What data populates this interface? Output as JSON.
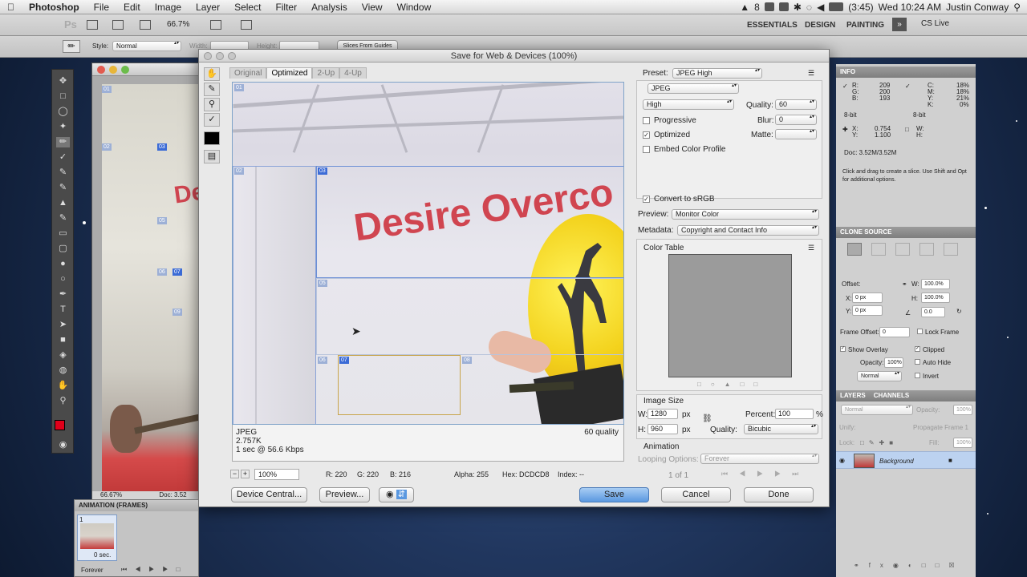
{
  "menubar": {
    "app": "Photoshop",
    "items": [
      "File",
      "Edit",
      "Image",
      "Layer",
      "Select",
      "Filter",
      "Analysis",
      "View",
      "Window"
    ],
    "status": {
      "adobe": "8",
      "battery": "(3:45)",
      "clock": "Wed 10:24 AM",
      "user": "Justin Conway"
    }
  },
  "options": {
    "logo": "Ps",
    "zoom": "66.7%",
    "workspaces": [
      "ESSENTIALS",
      "DESIGN",
      "PAINTING"
    ],
    "cslive": "CS Live",
    "style_label": "Style:",
    "style_value": "Normal",
    "width_label": "Width:",
    "height_label": "Height:",
    "slices_button": "Slices From Guides"
  },
  "doc": {
    "zoom": "66.67%",
    "doc_label": "Doc: 3.52",
    "slices": [
      "01",
      "02",
      "03",
      "05",
      "06",
      "07",
      "09"
    ]
  },
  "dialog": {
    "title": "Save for Web & Devices (100%)",
    "tabs": [
      "Original",
      "Optimized",
      "2-Up",
      "4-Up"
    ],
    "active_tab": "Optimized",
    "banner": "Desire Overco",
    "slices": [
      "01",
      "02",
      "03",
      "05",
      "06",
      "07",
      "08"
    ],
    "info": {
      "format": "JPEG",
      "size": "2.757K",
      "time": "1 sec @ 56.6 Kbps",
      "quality": "60 quality"
    },
    "status": {
      "zoom": "100%",
      "r": "R: 220",
      "g": "G: 220",
      "b": "B: 216",
      "alpha": "Alpha: 255",
      "hex": "Hex: DCDCD8",
      "index": "Index: --"
    },
    "buttons": {
      "device_central": "Device Central...",
      "preview": "Preview...",
      "save": "Save",
      "cancel": "Cancel",
      "done": "Done"
    },
    "settings": {
      "preset_label": "Preset:",
      "preset": "JPEG High",
      "format": "JPEG",
      "quality_level": "High",
      "quality_label": "Quality:",
      "quality": "60",
      "blur_label": "Blur:",
      "blur": "0",
      "matte_label": "Matte:",
      "progressive": "Progressive",
      "optimized": "Optimized",
      "embed": "Embed Color Profile",
      "convert": "Convert to sRGB",
      "preview_label": "Preview:",
      "preview": "Monitor Color",
      "metadata_label": "Metadata:",
      "metadata": "Copyright and Contact Info",
      "color_table": "Color Table"
    },
    "image_size": {
      "title": "Image Size",
      "w_label": "W:",
      "w": "1280",
      "h_label": "H:",
      "h": "960",
      "unit": "px",
      "percent_label": "Percent:",
      "percent": "100",
      "pct": "%",
      "quality_label": "Quality:",
      "quality": "Bicubic"
    },
    "animation": {
      "title": "Animation",
      "looping_label": "Looping Options:",
      "looping": "Forever",
      "frame": "1 of 1"
    }
  },
  "info_panel": {
    "title": "INFO",
    "r": "209",
    "g": "200",
    "b": "193",
    "c": "18%",
    "m": "18%",
    "y": "21%",
    "k": "0%",
    "bits1": "8-bit",
    "bits2": "8-bit",
    "x": "0.754",
    "yv": "1.100",
    "doc": "Doc: 3.52M/3.52M",
    "hint": "Click and drag to create a slice. Use Shift and Opt for additional options."
  },
  "clone_panel": {
    "title": "CLONE SOURCE",
    "offset": "Offset:",
    "x": "0 px",
    "y": "0 px",
    "w": "100.0%",
    "h": "100.0%",
    "angle": "0.0",
    "frame_offset": "Frame Offset:",
    "frame_value": "0",
    "lock_frame": "Lock Frame",
    "show_overlay": "Show Overlay",
    "clipped": "Clipped",
    "opacity_label": "Opacity:",
    "opacity": "100%",
    "auto_hide": "Auto Hide",
    "blend": "Normal",
    "invert": "Invert"
  },
  "layers_panel": {
    "tabs": [
      "LAYERS",
      "CHANNELS"
    ],
    "blend": "Normal",
    "opacity_label": "Opacity:",
    "opacity": "100%",
    "unify": "Unify:",
    "propagate": "Propagate Frame 1",
    "lock": "Lock:",
    "fill_label": "Fill:",
    "fill": "100%",
    "layer": "Background"
  },
  "anim_panel": {
    "title": "ANIMATION (FRAMES)",
    "frame_num": "1",
    "frame_time": "0 sec.",
    "loop": "Forever"
  }
}
